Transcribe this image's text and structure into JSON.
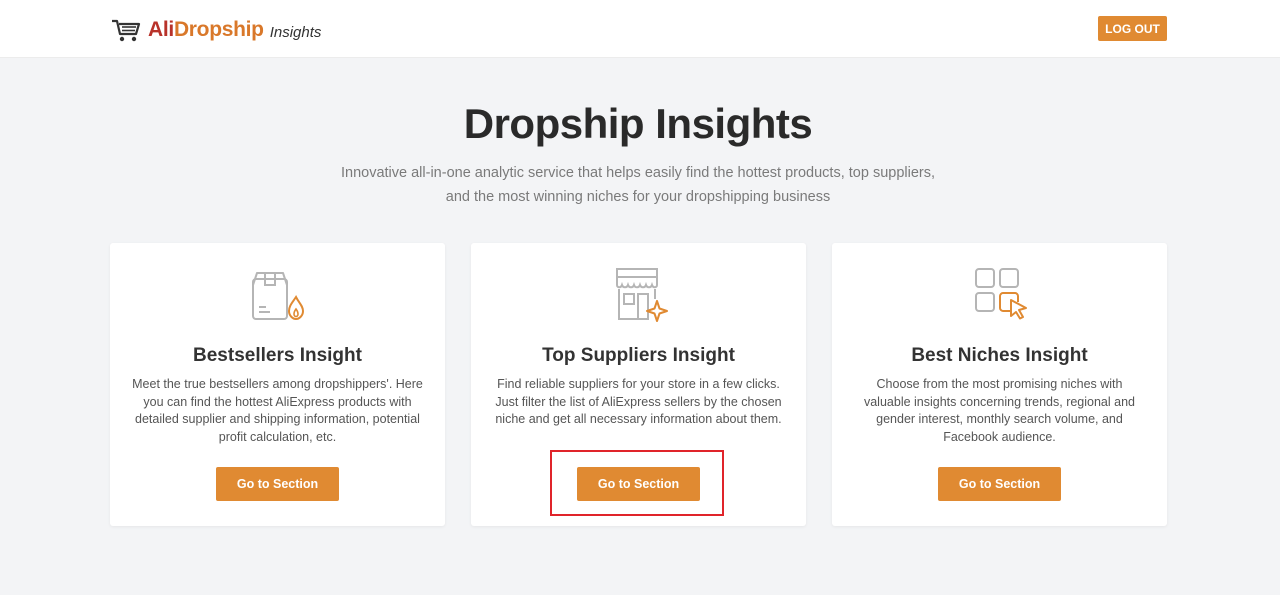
{
  "header": {
    "logo_part1": "Ali",
    "logo_part2": "Dropship",
    "logo_suffix": "Insights",
    "logout_label": "LOG OUT"
  },
  "hero": {
    "title": "Dropship Insights",
    "subtitle": "Innovative all-in-one analytic service that helps easily find the hottest products, top suppliers, and the most winning niches for your dropshipping business"
  },
  "cards": [
    {
      "icon": "box-fire-icon",
      "title": "Bestsellers Insight",
      "description": "Meet the true bestsellers among dropshippers'. Here you can find the hottest AliExpress products with detailed supplier and shipping information, potential profit calculation, etc.",
      "button_label": "Go to Section"
    },
    {
      "icon": "store-sparkle-icon",
      "title": "Top Suppliers Insight",
      "description": "Find reliable suppliers for your store in a few clicks. Just filter the list of AliExpress sellers by the chosen niche and get all necessary information about them.",
      "button_label": "Go to Section"
    },
    {
      "icon": "grid-cursor-icon",
      "title": "Best Niches Insight",
      "description": "Choose from the most promising niches with valuable insights concerning trends, regional and gender interest, monthly search volume, and Facebook audience.",
      "button_label": "Go to Section"
    }
  ],
  "colors": {
    "accent": "#e08a32",
    "logo_red": "#b8322a",
    "highlight": "#e0242a",
    "background": "#f3f4f6"
  }
}
